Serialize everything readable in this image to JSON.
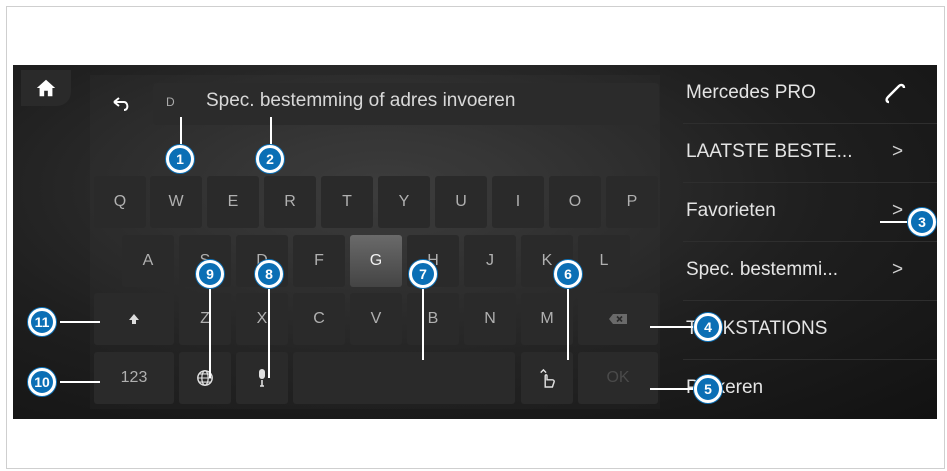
{
  "keyboard": {
    "country_code": "D",
    "input_placeholder": "Spec. bestemming of adres invoeren",
    "row1": [
      "Q",
      "W",
      "E",
      "R",
      "T",
      "Y",
      "U",
      "I",
      "O",
      "P"
    ],
    "row2": [
      "A",
      "S",
      "D",
      "F",
      "G",
      "H",
      "J",
      "K",
      "L"
    ],
    "row3": [
      "Z",
      "X",
      "C",
      "V",
      "B",
      "N",
      "M"
    ],
    "selected_key": "G",
    "numbers_label": "123",
    "ok_label": "OK"
  },
  "right_menu": {
    "items": [
      {
        "label": "Mercedes PRO",
        "icon": "phone-icon"
      },
      {
        "label": "LAATSTE BESTE...",
        "chevron": ">"
      },
      {
        "label": "Favorieten",
        "chevron": ">"
      },
      {
        "label": "Spec. bestemmi...",
        "chevron": ">"
      },
      {
        "label": "TANKSTATIONS"
      },
      {
        "label": "Parkeren"
      }
    ]
  },
  "callouts": [
    "1",
    "2",
    "3",
    "4",
    "5",
    "6",
    "7",
    "8",
    "9",
    "10",
    "11"
  ],
  "colors": {
    "callout": "#0b6fb5",
    "background": "#1f1f1f"
  }
}
